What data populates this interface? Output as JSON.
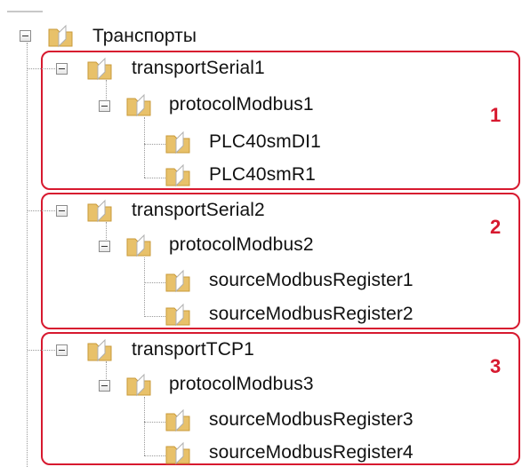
{
  "tree": {
    "root": {
      "label": "Транспорты"
    },
    "groups": [
      {
        "number": "1",
        "transport": "transportSerial1",
        "protocol": "protocolModbus1",
        "sources": [
          "PLC40smDI1",
          "PLC40smR1"
        ]
      },
      {
        "number": "2",
        "transport": "transportSerial2",
        "protocol": "protocolModbus2",
        "sources": [
          "sourceModbusRegister1",
          "sourceModbusRegister2"
        ]
      },
      {
        "number": "3",
        "transport": "transportTCP1",
        "protocol": "protocolModbus3",
        "sources": [
          "sourceModbusRegister3",
          "sourceModbusRegister4"
        ]
      }
    ]
  },
  "colors": {
    "highlight": "#d7192f",
    "folder": "#e8c16a",
    "folder_dark": "#c99a3a"
  },
  "icons": {
    "folder": "folder-icon",
    "expander": "collapse-minus-icon"
  }
}
